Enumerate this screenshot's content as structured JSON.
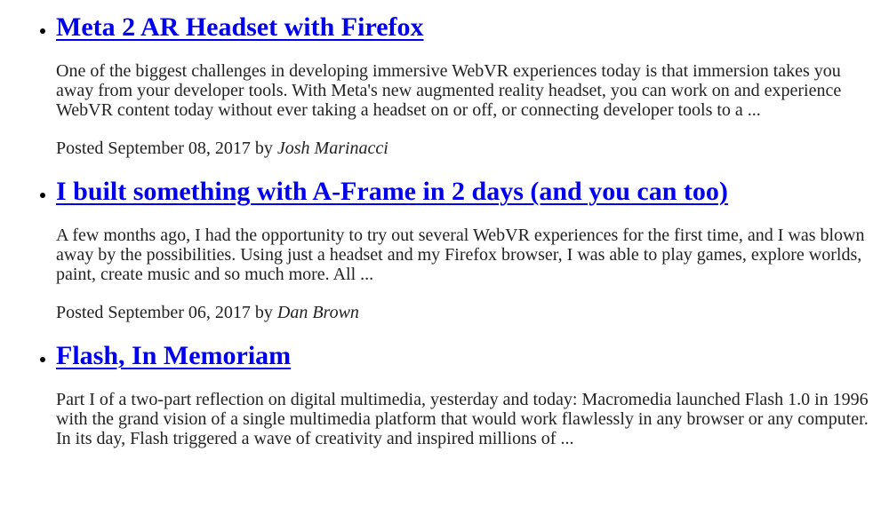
{
  "posts": [
    {
      "title": "Meta 2 AR Headset with Firefox",
      "excerpt": "One of the biggest challenges in developing immersive WebVR experiences today is that immersion takes you away from your developer tools. With Meta's new augmented reality headset, you can work on and experience WebVR content today without ever taking a headset on or off, or connecting developer tools to a ...",
      "posted_prefix": "Posted September 08, 2017 by",
      "author": "Josh Marinacci"
    },
    {
      "title": "I built something with A-Frame in 2 days (and you can too)",
      "excerpt": "A few months ago, I had the opportunity to try out several WebVR experiences for the first time, and I was blown away by the possibilities. Using just a headset and my Firefox browser, I was able to play games, explore worlds, paint, create music and so much more. All ...",
      "posted_prefix": "Posted September 06, 2017 by",
      "author": "Dan Brown"
    },
    {
      "title": "Flash, In Memoriam",
      "excerpt": "Part I of a two-part reflection on digital multimedia, yesterday and today: Macromedia launched Flash 1.0 in 1996 with the grand vision of a single multimedia platform that would work flawlessly in any browser or any computer. In its day, Flash triggered a wave of creativity and inspired millions of ..."
    }
  ],
  "colors": {
    "link": "#0000ee",
    "text": "#222222",
    "background": "#ffffff"
  }
}
